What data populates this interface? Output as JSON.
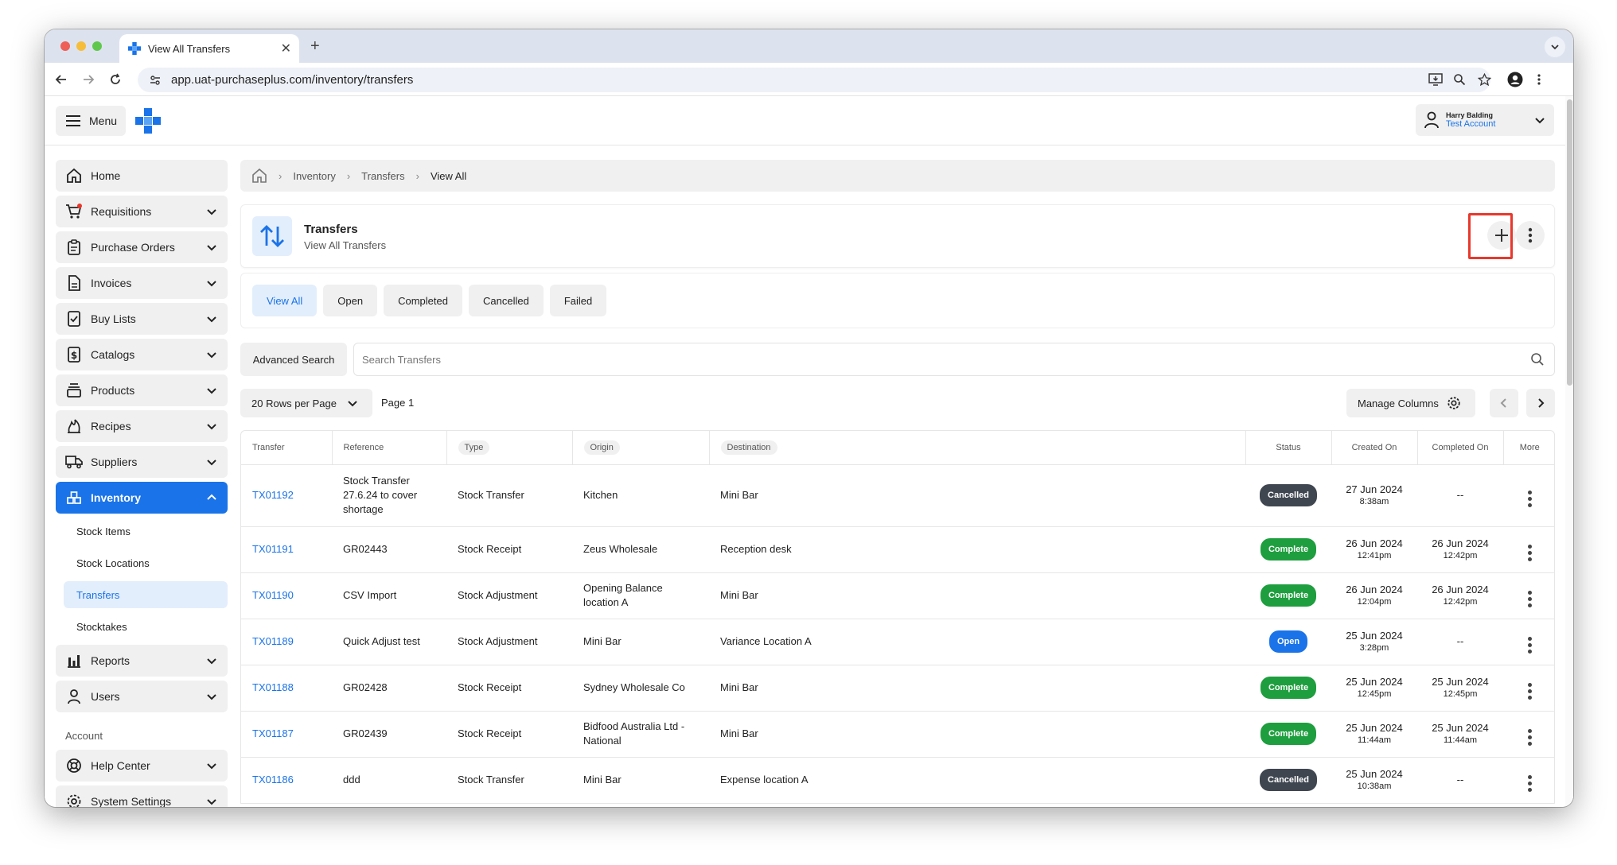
{
  "browser": {
    "tab_title": "View All Transfers",
    "url": "app.uat-purchaseplus.com/inventory/transfers"
  },
  "header": {
    "menu_label": "Menu",
    "user_name": "Harry Balding",
    "user_account": "Test Account"
  },
  "sidebar": {
    "items": [
      {
        "label": "Home",
        "icon": "home-icon"
      },
      {
        "label": "Requisitions",
        "icon": "cart-icon"
      },
      {
        "label": "Purchase Orders",
        "icon": "clipboard-icon"
      },
      {
        "label": "Invoices",
        "icon": "document-icon"
      },
      {
        "label": "Buy Lists",
        "icon": "checklist-icon"
      },
      {
        "label": "Catalogs",
        "icon": "dollar-doc-icon"
      },
      {
        "label": "Products",
        "icon": "stack-icon"
      },
      {
        "label": "Recipes",
        "icon": "flame-icon"
      },
      {
        "label": "Suppliers",
        "icon": "truck-icon"
      },
      {
        "label": "Inventory",
        "icon": "boxes-icon"
      }
    ],
    "inventory_sub": [
      "Stock Items",
      "Stock Locations",
      "Transfers",
      "Stocktakes"
    ],
    "items_after": [
      {
        "label": "Reports",
        "icon": "bar-chart-icon"
      },
      {
        "label": "Users",
        "icon": "user-icon"
      }
    ],
    "account_label": "Account",
    "account_items": [
      {
        "label": "Help Center",
        "icon": "lifebuoy-icon"
      },
      {
        "label": "System Settings",
        "icon": "gear-icon"
      }
    ]
  },
  "breadcrumb": {
    "items": [
      "Inventory",
      "Transfers",
      "View All"
    ]
  },
  "page": {
    "title": "Transfers",
    "subtitle": "View All Transfers"
  },
  "filters": {
    "tabs": [
      "View All",
      "Open",
      "Completed",
      "Cancelled",
      "Failed"
    ],
    "active": "View All"
  },
  "search": {
    "advanced_label": "Advanced Search",
    "placeholder": "Search Transfers"
  },
  "pagination": {
    "rows_label": "20 Rows per Page",
    "page_label": "Page 1",
    "manage_columns_label": "Manage Columns"
  },
  "colors": {
    "accent": "#1a73e8",
    "complete": "#1e9e3e",
    "cancelled": "#3f4650",
    "open": "#1a73e8",
    "highlight": "#e8382c"
  },
  "table": {
    "headers": [
      "Transfer",
      "Reference",
      "Type",
      "Origin",
      "Destination",
      "Status",
      "Created On",
      "Completed On",
      "More"
    ],
    "rows": [
      {
        "transfer": "TX01192",
        "reference": "Stock Transfer 27.6.24 to cover shortage",
        "type": "Stock Transfer",
        "origin": "Kitchen",
        "destination": "Mini Bar",
        "status": "Cancelled",
        "created_date": "27 Jun 2024",
        "created_time": "8:38am",
        "completed_date": "--",
        "completed_time": ""
      },
      {
        "transfer": "TX01191",
        "reference": "GR02443",
        "type": "Stock Receipt",
        "origin": "Zeus Wholesale",
        "destination": "Reception desk",
        "status": "Complete",
        "created_date": "26 Jun 2024",
        "created_time": "12:41pm",
        "completed_date": "26 Jun 2024",
        "completed_time": "12:42pm"
      },
      {
        "transfer": "TX01190",
        "reference": "CSV Import",
        "type": "Stock Adjustment",
        "origin": "Opening Balance location A",
        "destination": "Mini Bar",
        "status": "Complete",
        "created_date": "26 Jun 2024",
        "created_time": "12:04pm",
        "completed_date": "26 Jun 2024",
        "completed_time": "12:42pm"
      },
      {
        "transfer": "TX01189",
        "reference": "Quick Adjust test",
        "type": "Stock Adjustment",
        "origin": "Mini Bar",
        "destination": "Variance Location A",
        "status": "Open",
        "created_date": "25 Jun 2024",
        "created_time": "3:28pm",
        "completed_date": "--",
        "completed_time": ""
      },
      {
        "transfer": "TX01188",
        "reference": "GR02428",
        "type": "Stock Receipt",
        "origin": "Sydney Wholesale Co",
        "destination": "Mini Bar",
        "status": "Complete",
        "created_date": "25 Jun 2024",
        "created_time": "12:45pm",
        "completed_date": "25 Jun 2024",
        "completed_time": "12:45pm"
      },
      {
        "transfer": "TX01187",
        "reference": "GR02439",
        "type": "Stock Receipt",
        "origin": "Bidfood Australia Ltd - National",
        "destination": "Mini Bar",
        "status": "Complete",
        "created_date": "25 Jun 2024",
        "created_time": "11:44am",
        "completed_date": "25 Jun 2024",
        "completed_time": "11:44am"
      },
      {
        "transfer": "TX01186",
        "reference": "ddd",
        "type": "Stock Transfer",
        "origin": "Mini Bar",
        "destination": "Expense location A",
        "status": "Cancelled",
        "created_date": "25 Jun 2024",
        "created_time": "10:38am",
        "completed_date": "--",
        "completed_time": ""
      }
    ]
  }
}
